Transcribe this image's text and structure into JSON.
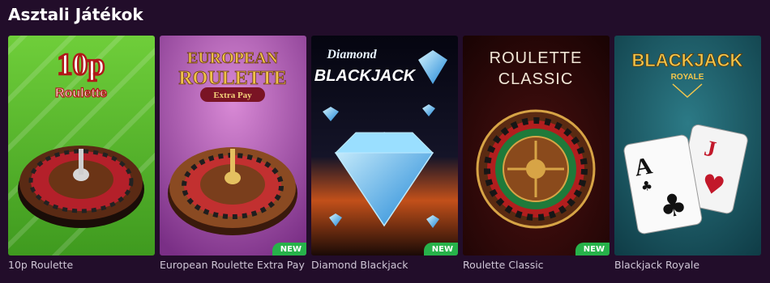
{
  "section": {
    "title": "Asztali Játékok"
  },
  "games": [
    {
      "title": "10p Roulette",
      "art_title_1": "10p",
      "art_title_2": "Roulette",
      "new": false
    },
    {
      "title": "European Roulette Extra Pay",
      "art_title_1": "EUROPEAN",
      "art_title_2": "ROULETTE",
      "art_subtitle": "Extra Pay",
      "new": true,
      "badge": "NEW"
    },
    {
      "title": "Diamond Blackjack",
      "art_title_1": "Diamond",
      "art_title_2": "BLACKJACK",
      "new": true,
      "badge": "NEW"
    },
    {
      "title": "Roulette Classic",
      "art_title_1": "ROULETTE",
      "art_title_2": "CLASSIC",
      "new": true,
      "badge": "NEW"
    },
    {
      "title": "Blackjack Royale",
      "art_title_1": "BLACKJACK",
      "art_title_2": "ROYALE",
      "card_1": "A",
      "card_2": "J",
      "new": false
    }
  ],
  "colors": {
    "background": "#220d2a",
    "badge": "#27b24a",
    "caption": "#cfc6d6"
  }
}
